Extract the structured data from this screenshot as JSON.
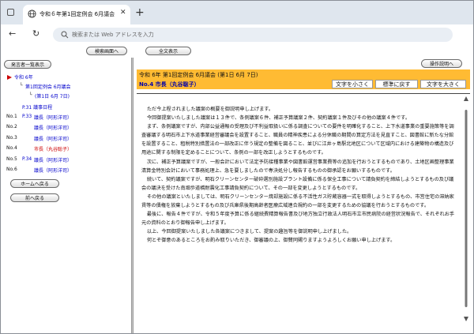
{
  "browser": {
    "tab_title": "令和６年第1回定例会 6月議会（第",
    "address_placeholder": "検索または Web アドレスを入力"
  },
  "left": {
    "search_button": "検索画面へ",
    "speaker_list_button": "発言者一覧表示",
    "tree_root": "令和 6年",
    "tree_session": "第1回定例会 6月議会",
    "tree_day": "(第1日 6月 7日)",
    "schedule": "P.31 議事日程",
    "speakers": [
      {
        "no": "No.1",
        "page": "P.33",
        "name": "議長（阿形洋司）",
        "color": "blue"
      },
      {
        "no": "No.2",
        "page": "",
        "name": "議長（阿形洋司）",
        "color": "blue"
      },
      {
        "no": "No.3",
        "page": "",
        "name": "議長（阿形洋司）",
        "color": "blue"
      },
      {
        "no": "No.4",
        "page": "",
        "name": "市長（丸谷聡子）",
        "color": "red"
      },
      {
        "no": "No.5",
        "page": "P.34",
        "name": "議長（阿形洋司）",
        "color": "blue"
      },
      {
        "no": "No.6",
        "page": "",
        "name": "議長（阿形洋司）",
        "color": "blue"
      }
    ],
    "home_button": "ホームへ戻る",
    "back_button": "前へ戻る"
  },
  "main": {
    "show_all_button": "全文表示",
    "help_button": "操作説明へ",
    "session_title": "令和 6年 第1回定例会 6月議会 (第1日 6月 7日)",
    "speaker_label": "No.4 市長（丸谷聡子）",
    "text_smaller": "文字を小さく",
    "text_reset": "標準に戻す",
    "text_larger": "文字を大きく",
    "paragraphs": [
      "ただ今上程されました議案の概要を御説明申し上げます。",
      "今回御提案いたしました議案は１３件で、条例議案６件、補正予算議案２件、契約議案１件及びその他の議案４件です。",
      "まず、条例議案ですが、内部公益通報の受理及び不利益取扱いに係る調査についての要件を明確化すること、上下水道事業の重要施策等を調査審議する明石市上下水道事業経営審議会を設置すること、職員の精神疾患による分休職の期間の算定方法を見直すこと、図書館に新たな分館を設置すること、租税特別措置法の一部改正に伴う規定の整備を図ること、並びに江井ヶ島駅北地区について区域内における建築物の構造及び用途に関する制限を定めることについて、条例の一部を改正しようとするものです。",
      "次に、補正予算議案ですが、一般会計において法定予防接種事業や図書館運営事業費等の追加を行おうとするものであり、土地区画整理事業清算金特別会計において事務処理上、急を要しましたので専決処分し報告するものの御承認をお願いするものです。",
      "続いて、契約議案ですが、明石クリーンセンター破砕選別施設プラント設備に係る保全工事について請負契約を締結しようとするもの及び議会の議決を受けた南畑歩道橋耐震化工事請負契約について、その一部を変更しようとするものです。",
      "その他の議案といたしましては、明石クリーンセンター焼却施設に係る不活性ガス貯蔵容器一式を取得しようとするもの、市営住宅の滞納家賃等の債権を放棄しようとするもの及び兵庫県後期高齢者医療広域連合規約の一部を変更するための協議を行おうとするものです。",
      "最後に、報告４件ですが、令和５年度予算に係る継続費精算報告書及び地方独立行政法人明石市立市民病院の経営状況報告で、それぞれお手元の資料のとおり御報告申し上げます。",
      "以上、今回御提案いたしました各議案につきまして、提案の趣旨等を御説明申し上げました。",
      "何とぞ御意のあるところをお酌み取りいただき、御審議の上、御賛同賜りますようよろしくお願い申し上げます。"
    ]
  }
}
